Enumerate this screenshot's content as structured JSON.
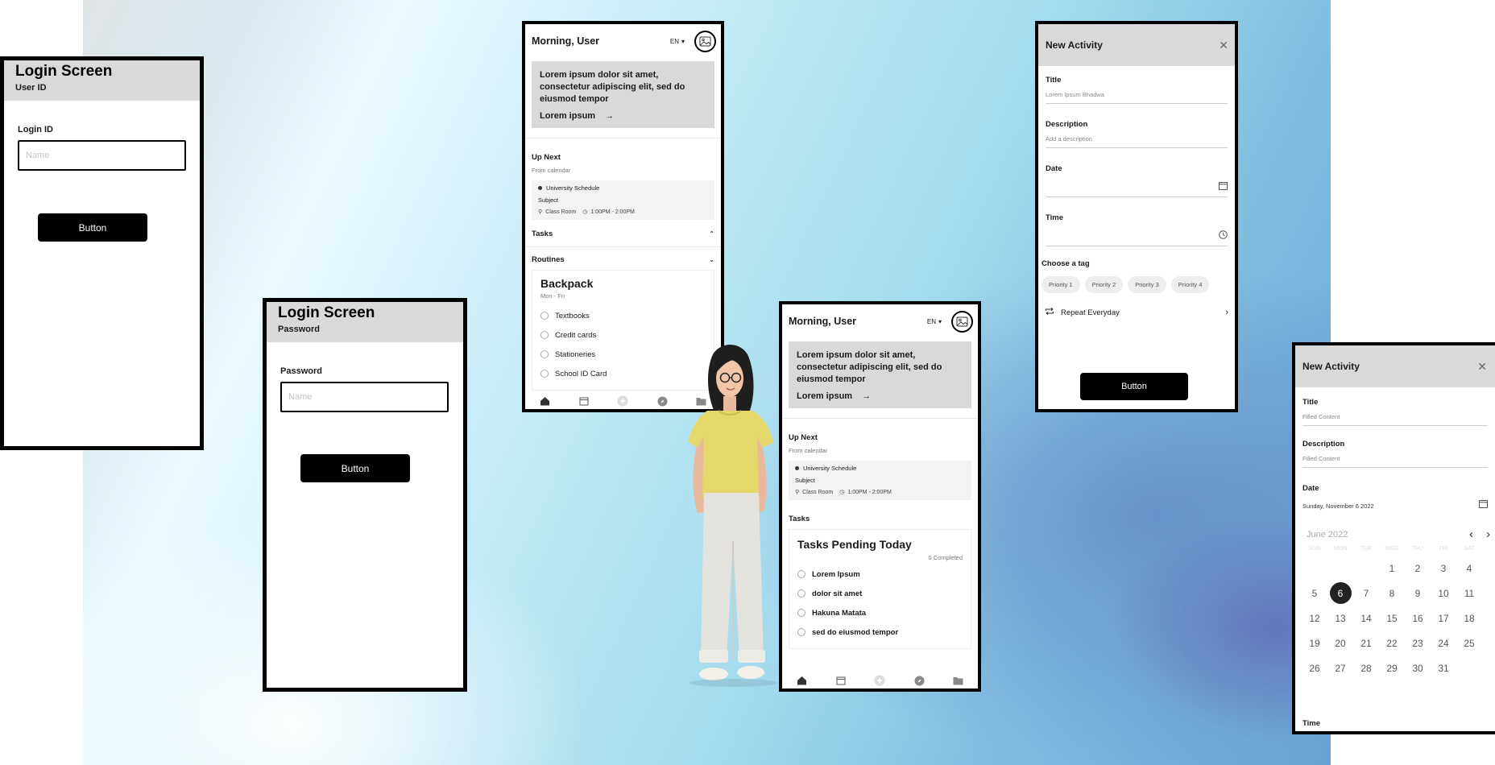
{
  "login1": {
    "title": "Login Screen",
    "subtitle": "User ID",
    "field_label": "Login ID",
    "placeholder": "Name",
    "button": "Button"
  },
  "login2": {
    "title": "Login Screen",
    "subtitle": "Password",
    "field_label": "Password",
    "placeholder": "Name",
    "button": "Button"
  },
  "dash1": {
    "greeting": "Morning, User",
    "lang": "EN",
    "promo_text": "Lorem ipsum dolor sit amet, consectetur adipiscing elit, sed do eiusmod tempor",
    "promo_link": "Lorem ipsum",
    "up_next": "Up Next",
    "from_calendar": "From calendar",
    "event_title": "University Schedule",
    "event_subject": "Subject",
    "event_place": "Class Room",
    "event_time": "1:00PM - 2:00PM",
    "tasks": "Tasks",
    "routines": "Routines",
    "card_title": "Backpack",
    "card_sub": "Mon - Fri",
    "items": [
      "Textbooks",
      "Credit cards",
      "Stationeries",
      "School ID Card"
    ]
  },
  "dash2": {
    "greeting": "Morning, User",
    "lang": "EN",
    "promo_text": "Lorem ipsum dolor sit amet, consectetur adipiscing elit, sed do eiusmod tempor",
    "promo_link": "Lorem ipsum",
    "up_next": "Up Next",
    "from_calendar": "From calendar",
    "event_title": "University Schedule",
    "event_subject": "Subject",
    "event_place": "Class Room",
    "event_time": "1:00PM - 2:00PM",
    "tasks": "Tasks",
    "card_title": "Tasks Pending Today",
    "completed": "0 Completed",
    "items": [
      "Lorem Ipsum",
      "dolor sit amet",
      "Hakuna Matata",
      "sed do eiusmod tempor"
    ]
  },
  "act1": {
    "header": "New Activity",
    "title_label": "Title",
    "title_value": "Lorem Ipsum Bhadwa",
    "desc_label": "Description",
    "desc_value": "Add a description",
    "date_label": "Date",
    "time_label": "Time",
    "tag_label": "Choose a tag",
    "tags": [
      "Priority 1",
      "Priority 2",
      "Priority 3",
      "Priority 4"
    ],
    "repeat": "Repeat Everyday",
    "button": "Button"
  },
  "act2": {
    "header": "New Activity",
    "title_label": "Title",
    "title_value": "Filled Content",
    "desc_label": "Description",
    "desc_value": "Filled Content",
    "date_label": "Date",
    "date_value": "Sunday, November 6 2022",
    "month": "June 2022",
    "weekdays": [
      "SUN",
      "MON",
      "TUE",
      "WED",
      "THU",
      "FRI",
      "SAT"
    ],
    "days": [
      "",
      "",
      "",
      "1",
      "2",
      "3",
      "4",
      "5",
      "6",
      "7",
      "8",
      "9",
      "10",
      "11",
      "12",
      "13",
      "14",
      "15",
      "16",
      "17",
      "18",
      "19",
      "20",
      "21",
      "22",
      "23",
      "24",
      "25",
      "26",
      "27",
      "28",
      "29",
      "30",
      "31"
    ],
    "selected_day": "6",
    "time_label": "Time"
  }
}
